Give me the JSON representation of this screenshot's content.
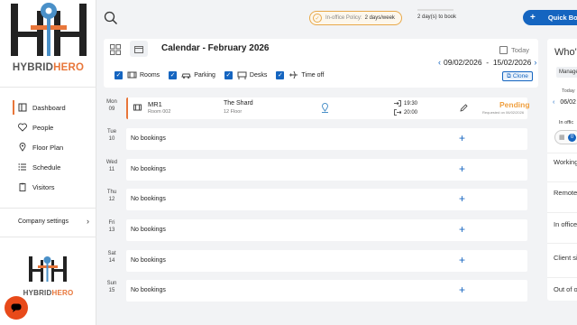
{
  "brand": {
    "name_part1": "HYBRID",
    "name_part2": "HERO",
    "accent": "#e8763a",
    "primary": "#1565c0"
  },
  "sidebar": {
    "items": [
      {
        "label": "Dashboard",
        "icon": "dashboard-icon",
        "active": true
      },
      {
        "label": "People",
        "icon": "heart-pulse-icon"
      },
      {
        "label": "Floor Plan",
        "icon": "map-pin-icon"
      },
      {
        "label": "Schedule",
        "icon": "list-icon"
      },
      {
        "label": "Visitors",
        "icon": "clipboard-icon"
      }
    ],
    "company_settings": "Company settings"
  },
  "topbar": {
    "policy_label": "In-office Policy:",
    "policy_value": "2 days/week",
    "days_to_book": "2 day(s) to book",
    "quick_book": "Quick Bo"
  },
  "calendar": {
    "title": "Calendar - February 2026",
    "today_label": "Today",
    "date_range": "09/02/2026  -  15/02/2026",
    "filters": [
      "Rooms",
      "Parking",
      "Desks",
      "Time off"
    ],
    "clone_label": "Clone"
  },
  "days": [
    {
      "dow": "Mon",
      "num": "09",
      "booking": {
        "name": "MR1",
        "room": "Room 002",
        "location": "The Shard",
        "floor": "12 Floor",
        "start": "19:30",
        "end": "20:00",
        "status": "Pending",
        "requested": "Requested on 06/02/2026"
      }
    },
    {
      "dow": "Tue",
      "num": "10",
      "empty": "No bookings"
    },
    {
      "dow": "Wed",
      "num": "11",
      "empty": "No bookings"
    },
    {
      "dow": "Thu",
      "num": "12",
      "empty": "No bookings"
    },
    {
      "dow": "Fri",
      "num": "13",
      "empty": "No bookings"
    },
    {
      "dow": "Sat",
      "num": "14",
      "empty": "No bookings"
    },
    {
      "dow": "Sun",
      "num": "15",
      "empty": "No bookings"
    }
  ],
  "right_panel": {
    "title": "Who's",
    "manage": "Manage",
    "today": "Today",
    "date": "06/02",
    "in_office_label": "In offic",
    "count": "0",
    "statuses": [
      "Working",
      "Remote",
      "In office",
      "Client si",
      "Out of o"
    ]
  }
}
